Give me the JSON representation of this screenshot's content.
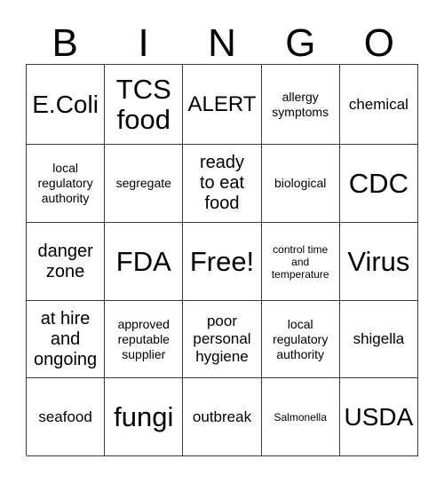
{
  "card": {
    "type": "bingo-card",
    "columns": 5,
    "rows": 5,
    "header": [
      "B",
      "I",
      "N",
      "G",
      "O"
    ],
    "free_space": "Free!",
    "free_space_position": {
      "row": 3,
      "column": 3
    },
    "colors": {
      "background": "#ffffff",
      "text": "#000000",
      "grid_line": "#3a3a3a"
    },
    "cells": [
      [
        {
          "text": "E.Coli",
          "size": "fs-xl"
        },
        {
          "text": "TCS\nfood",
          "size": "fs-xxl"
        },
        {
          "text": "ALERT",
          "size": "fs-l"
        },
        {
          "text": "allergy\nsymptoms",
          "size": "fs-xs"
        },
        {
          "text": "chemical",
          "size": "fs-s"
        }
      ],
      [
        {
          "text": "local\nregulatory\nauthority",
          "size": "fs-xs"
        },
        {
          "text": "segregate",
          "size": "fs-xs"
        },
        {
          "text": "ready\nto eat\nfood",
          "size": "fs-m"
        },
        {
          "text": "biological",
          "size": "fs-xs"
        },
        {
          "text": "CDC",
          "size": "fs-xxl"
        }
      ],
      [
        {
          "text": "danger\nzone",
          "size": "fs-m"
        },
        {
          "text": "FDA",
          "size": "fs-xxl"
        },
        {
          "text": "Free!",
          "size": "fs-xxl"
        },
        {
          "text": "control time\nand\ntemperature",
          "size": "fs-xxs"
        },
        {
          "text": "Virus",
          "size": "fs-xxl"
        }
      ],
      [
        {
          "text": "at hire\nand\nongoing",
          "size": "fs-m"
        },
        {
          "text": "approved\nreputable\nsupplier",
          "size": "fs-xs"
        },
        {
          "text": "poor\npersonal\nhygiene",
          "size": "fs-s"
        },
        {
          "text": "local\nregulatory\nauthority",
          "size": "fs-xs"
        },
        {
          "text": "shigella",
          "size": "fs-s"
        }
      ],
      [
        {
          "text": "seafood",
          "size": "fs-s"
        },
        {
          "text": "fungi",
          "size": "fs-xxl"
        },
        {
          "text": "outbreak",
          "size": "fs-s"
        },
        {
          "text": "Salmonella",
          "size": "fs-xxs"
        },
        {
          "text": "USDA",
          "size": "fs-xl"
        }
      ]
    ]
  }
}
